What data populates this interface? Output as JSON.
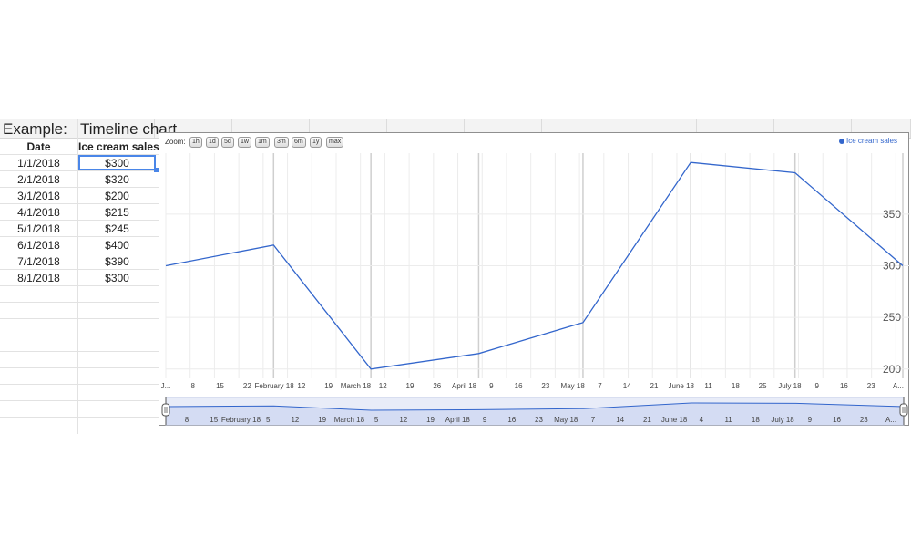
{
  "sheet": {
    "title_left": "Example:",
    "title_right": "Timeline chart",
    "headers": {
      "date": "Date",
      "sales": "Ice cream sales"
    },
    "rows": [
      {
        "date": "1/1/2018",
        "sales": "$300"
      },
      {
        "date": "2/1/2018",
        "sales": "$320"
      },
      {
        "date": "3/1/2018",
        "sales": "$200"
      },
      {
        "date": "4/1/2018",
        "sales": "$215"
      },
      {
        "date": "5/1/2018",
        "sales": "$245"
      },
      {
        "date": "6/1/2018",
        "sales": "$400"
      },
      {
        "date": "7/1/2018",
        "sales": "$390"
      },
      {
        "date": "8/1/2018",
        "sales": "$300"
      }
    ]
  },
  "chart": {
    "zoom_label": "Zoom:",
    "zoom_buttons": [
      "1h",
      "1d",
      "5d",
      "1w",
      "1m",
      "3m",
      "6m",
      "1y",
      "max"
    ],
    "legend": "Ice cream sales",
    "line_color": "#3366cc"
  },
  "chart_data": {
    "type": "line",
    "x": [
      "2018-01-01",
      "2018-02-01",
      "2018-03-01",
      "2018-04-01",
      "2018-05-01",
      "2018-06-01",
      "2018-07-01",
      "2018-08-01"
    ],
    "series": [
      {
        "name": "Ice cream sales",
        "values": [
          300,
          320,
          200,
          215,
          245,
          400,
          390,
          300
        ]
      }
    ],
    "y_ticks": [
      200,
      250,
      300,
      350
    ],
    "x_tick_labels": [
      "J...",
      "8",
      "15",
      "22",
      "February 18",
      "12",
      "19",
      "March 18",
      "12",
      "19",
      "26",
      "April 18",
      "9",
      "16",
      "23",
      "May 18",
      "7",
      "14",
      "21",
      "June 18",
      "11",
      "18",
      "25",
      "July 18",
      "9",
      "16",
      "23",
      "A..."
    ],
    "range_tick_labels": [
      "8",
      "15",
      "February 18",
      "5",
      "12",
      "19",
      "March 18",
      "5",
      "12",
      "19",
      "April 18",
      "9",
      "16",
      "23",
      "May 18",
      "7",
      "14",
      "21",
      "June 18",
      "4",
      "11",
      "18",
      "July 18",
      "9",
      "16",
      "23",
      "A..."
    ],
    "y_axis_position": "right",
    "grid": true
  }
}
